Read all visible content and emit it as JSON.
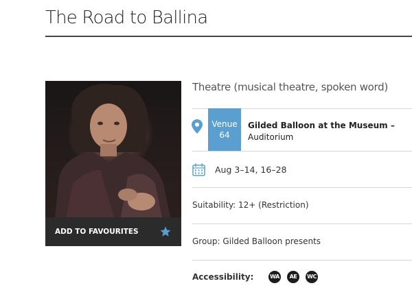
{
  "show": {
    "title": "The Road to Ballina",
    "genre": "Theatre (musical theatre, spoken word)"
  },
  "favourites": {
    "label": "ADD TO FAVOURITES",
    "icon": "star-icon",
    "icon_color": "#5a9fd0"
  },
  "venue": {
    "badge_word": "Venue",
    "badge_number": "64",
    "name_line1": "Gilded Balloon at the Museum –",
    "name_line2": "Auditorium",
    "badge_color": "#5a9fd0",
    "pin_icon": "map-pin-icon"
  },
  "dates": {
    "text": "Aug 3–14, 16–28",
    "icon": "calendar-icon"
  },
  "suitability": "Suitability: 12+ (Restriction)",
  "group": "Group: Gilded Balloon presents",
  "accessibility": {
    "label": "Accessibility:",
    "icons": [
      {
        "name": "wheelchair-access-icon",
        "text": "WA"
      },
      {
        "name": "access-enhanced-icon",
        "text": "AE"
      },
      {
        "name": "wheelchair-compatible-icon",
        "text": "WC"
      }
    ]
  }
}
